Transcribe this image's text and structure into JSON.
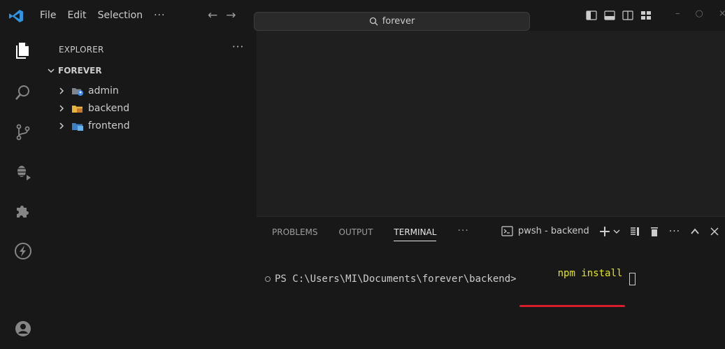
{
  "titlebar": {
    "menu": [
      "File",
      "Edit",
      "Selection"
    ],
    "more": "···",
    "search": {
      "text": "forever",
      "icon": "search-icon"
    },
    "window_controls": [
      "–",
      "○",
      "×"
    ]
  },
  "activitybar": {
    "items": [
      "explorer-icon",
      "search-icon",
      "source-control-icon",
      "run-debug-icon",
      "extensions-icon",
      "thunder-client-icon",
      "account-icon"
    ]
  },
  "sidebar": {
    "header": "EXPLORER",
    "more": "···",
    "root": "FOREVER",
    "items": [
      {
        "label": "admin",
        "icon": "admin-folder-icon"
      },
      {
        "label": "backend",
        "icon": "folder-icon"
      },
      {
        "label": "frontend",
        "icon": "frontend-folder-icon"
      }
    ]
  },
  "panel": {
    "tabs": [
      "PROBLEMS",
      "OUTPUT",
      "TERMINAL"
    ],
    "active_tab": "TERMINAL",
    "more": "···",
    "terminal_name": "pwsh - backend",
    "actions_more": "···"
  },
  "terminal": {
    "prompt": "PS C:\\Users\\MI\\Documents\\forever\\backend>",
    "command": "npm install"
  },
  "colors": {
    "accent_blue": "#3b8eea",
    "command_yellow": "#e5e510",
    "underline_red": "#d81d2a"
  }
}
